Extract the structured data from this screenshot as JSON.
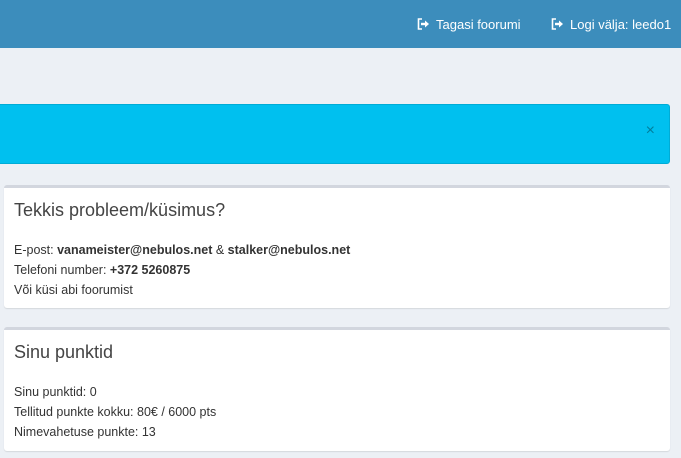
{
  "topbar": {
    "back_label": "Tagasi foorumi",
    "logout_label": "Logi välja: leedo1",
    "back_icon": "sign-out-icon",
    "logout_icon": "sign-out-icon",
    "bg_color": "#3c8dbc"
  },
  "alert": {
    "close_symbol": "×",
    "bg_color": "#00c0ef"
  },
  "help_box": {
    "title": "Tekkis probleem/küsimus?",
    "email_label": "E-post: ",
    "email_1": "vanameister@nebulos.net",
    "email_sep": " & ",
    "email_2": "stalker@nebulos.net",
    "phone_label": "Telefoni number: ",
    "phone": "+372 5260875",
    "forum_text": "Või küsi abi foorumist"
  },
  "points_box": {
    "title": "Sinu punktid",
    "points_line": "Sinu punktid: 0",
    "ordered_line": "Tellitud punkte kokku: 80€ / 6000 pts",
    "rename_line": "Nimevahetuse punkte: 13"
  }
}
